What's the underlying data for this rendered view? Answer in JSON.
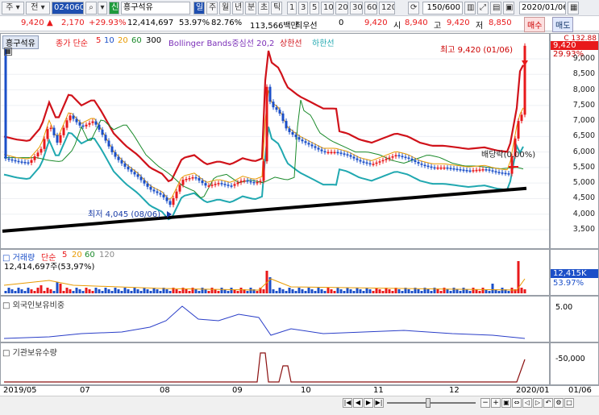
{
  "toolbar": {
    "item1": "주",
    "item2": "전",
    "code": "024060",
    "sin_badge": "신",
    "name": "흥구석유",
    "periods": [
      "일",
      "주",
      "월",
      "년",
      "분",
      "초",
      "틱"
    ],
    "minutes": [
      "1",
      "3",
      "5",
      "10",
      "20",
      "30",
      "60",
      "120"
    ],
    "count": "150/600",
    "date": "2020/01/06"
  },
  "info": {
    "price": "9,420",
    "change": "2,170",
    "change_pct": "+29.93%",
    "volume": "12,414,697",
    "ratio1": "53.97%",
    "ratio2": "82.76%",
    "amount": "113,566백만",
    "best_ask_label": "최우선",
    "best_ask": "0",
    "current": "9,420",
    "open_label": "시",
    "open": "8,940",
    "high_label": "고",
    "high": "9,420",
    "low_label": "저",
    "low": "8,850",
    "buy": "매수",
    "sell": "매도"
  },
  "main_legend": {
    "name": "흥구석유",
    "ma_label": "종가 단순",
    "ma": [
      "5",
      "10",
      "20",
      "60",
      "300"
    ],
    "bb": "Bollinger Bands중심선 20,2",
    "upper": "상한선",
    "lower": "하한선"
  },
  "annotations": {
    "high": "최고 9,420 (01/06)",
    "low": "최저 4,045 (08/06)",
    "dividend": "배당락(0.00%)"
  },
  "price_axis": {
    "ticks": [
      "9,000",
      "8,500",
      "8,000",
      "7,500",
      "7,000",
      "6,500",
      "6,000",
      "5,500",
      "5,000",
      "4,500",
      "4,000",
      "3,500"
    ],
    "top_label": "C 132.88",
    "price_tag": "9,420",
    "pct_tag": "29.93%"
  },
  "volume_legend": {
    "label": "거래량",
    "ma_label": "단순",
    "ma": [
      "5",
      "20",
      "60",
      "120"
    ],
    "value_line": "12,414,697주(53,97%)"
  },
  "volume_axis": {
    "tag": "12,415K",
    "pct": "53.97%"
  },
  "foreign_legend": {
    "label": "외국인보유비중"
  },
  "foreign_axis": {
    "tick": "5.00"
  },
  "inst_legend": {
    "label": "기관보유수량"
  },
  "inst_axis": {
    "tick": "-50,000"
  },
  "x_axis": {
    "labels": [
      "2019/05",
      "07",
      "08",
      "09",
      "10",
      "11",
      "12",
      "2020/01"
    ],
    "right_label": "01/06"
  },
  "colors": {
    "up": "#e8191b",
    "down": "#1b4fc8",
    "upper_band": "#d0121a",
    "lower_band": "#20a8b0",
    "trend": "#000000"
  }
}
